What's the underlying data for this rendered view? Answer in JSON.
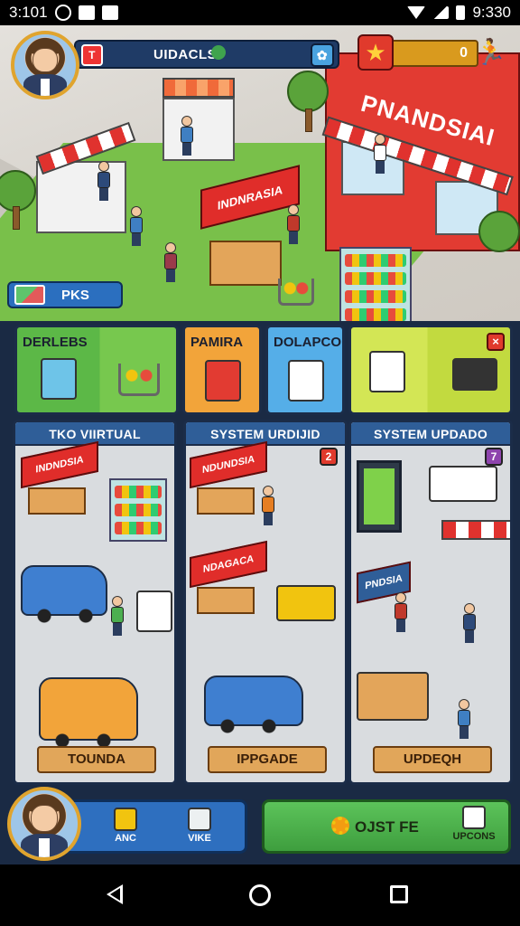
{
  "status_bar": {
    "time": "3:101",
    "right_time": "9:330"
  },
  "hud": {
    "player_name": "UIDACLS",
    "coins": "0"
  },
  "scene": {
    "shop_sign": "PNANDSIAI",
    "kiosk_sign": "INDNRASIA",
    "pks_label": "PKS"
  },
  "categories": [
    {
      "label": "DERLEBS"
    },
    {
      "label": "PAMIRA"
    },
    {
      "label": "DOLAPCO"
    },
    {
      "label": ""
    }
  ],
  "panels": [
    {
      "title": "TKO VIIRTUAL",
      "shop_sign": "INDNDSIA",
      "button": "TOUNDA"
    },
    {
      "title": "SYSTEM URDIJID",
      "shop_sign": "NDUNDSIA",
      "shop_sign_2": "NDAGACA",
      "badge": "2",
      "button": "IPPGADE"
    },
    {
      "title": "SYSTEM UPDADO",
      "shop_sign": "PNDSIA",
      "badge": "7",
      "button": "UPDEQH"
    }
  ],
  "bottom_bar": {
    "btn1_label": "ANC",
    "btn2_label": "VIKE",
    "main_label": "OJST FE",
    "upgrades_label": "UPCONS"
  },
  "colors": {
    "hud_blue": "#1f3b66",
    "accent_red": "#e02d2a",
    "action_green": "#4caf4a",
    "coin_gold": "#d99a1e"
  },
  "icons": [
    "star-icon",
    "runner-icon",
    "globe-icon",
    "tag-icon",
    "close-icon",
    "gear-icon",
    "cart-icon",
    "back-icon",
    "home-icon",
    "recent-apps-icon"
  ]
}
